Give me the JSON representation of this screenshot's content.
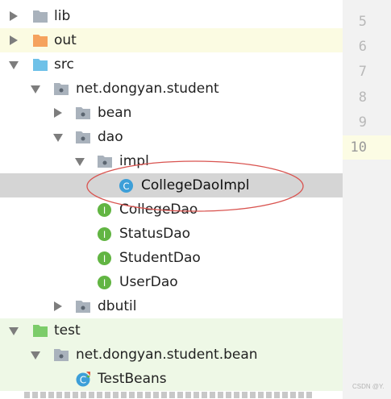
{
  "tree": {
    "items": [
      {
        "label": "lib",
        "icon": "folder-icon"
      },
      {
        "label": "out",
        "icon": "folder-icon"
      },
      {
        "label": "src",
        "icon": "folder-icon"
      },
      {
        "label": "net.dongyan.student",
        "icon": "package-icon"
      },
      {
        "label": "bean",
        "icon": "package-icon"
      },
      {
        "label": "dao",
        "icon": "package-icon"
      },
      {
        "label": "impl",
        "icon": "package-icon"
      },
      {
        "label": "CollegeDaoImpl",
        "icon": "class-icon",
        "badge": "C"
      },
      {
        "label": "CollegeDao",
        "icon": "interface-icon",
        "badge": "I"
      },
      {
        "label": "StatusDao",
        "icon": "interface-icon",
        "badge": "I"
      },
      {
        "label": "StudentDao",
        "icon": "interface-icon",
        "badge": "I"
      },
      {
        "label": "UserDao",
        "icon": "interface-icon",
        "badge": "I"
      },
      {
        "label": "dbutil",
        "icon": "package-icon"
      },
      {
        "label": "test",
        "icon": "folder-icon"
      },
      {
        "label": "net.dongyan.student.bean",
        "icon": "package-icon"
      },
      {
        "label": "TestBeans",
        "icon": "test-class-icon",
        "badge": "C"
      }
    ]
  },
  "gutter": {
    "line_numbers": [
      "5",
      "6",
      "7",
      "8",
      "9",
      "10"
    ]
  },
  "watermark": "CSDN @Y.",
  "colors": {
    "selection": "#d5d5d5",
    "excluded_folder_bg": "#fbfbe2",
    "test_folder_bg": "#eef8e6",
    "annotation_circle": "#d9534f",
    "class_icon": "#3d9fd8",
    "interface_icon": "#62b543"
  }
}
